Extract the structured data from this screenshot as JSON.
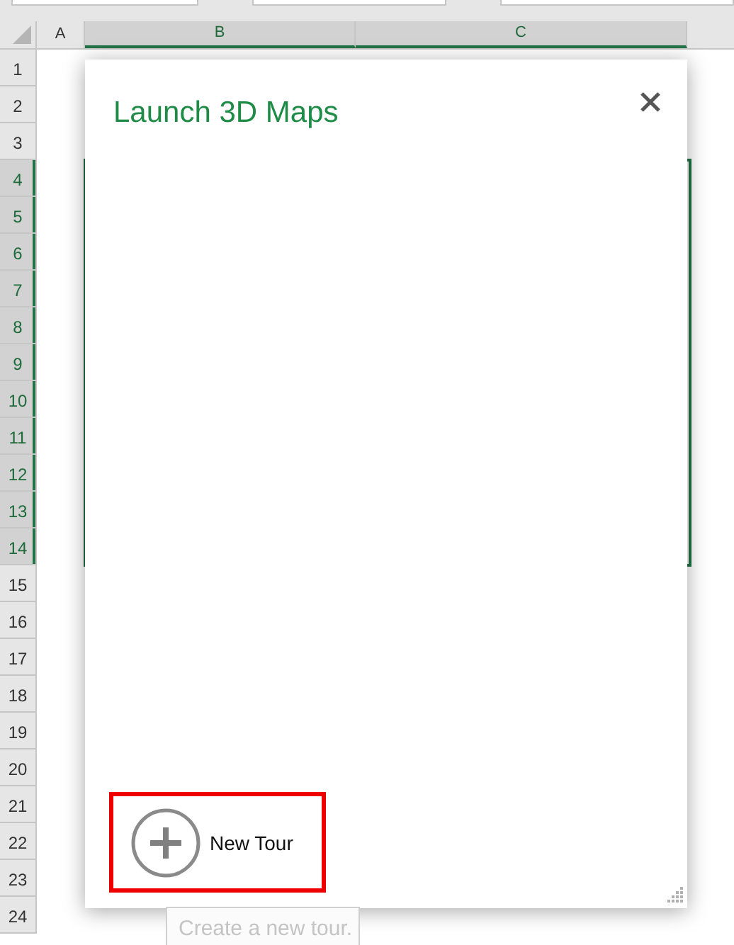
{
  "columns": [
    {
      "label": "A",
      "selected": false
    },
    {
      "label": "B",
      "selected": true
    },
    {
      "label": "C",
      "selected": true
    }
  ],
  "rows": [
    {
      "label": "1",
      "selected": false
    },
    {
      "label": "2",
      "selected": false
    },
    {
      "label": "3",
      "selected": false
    },
    {
      "label": "4",
      "selected": true
    },
    {
      "label": "5",
      "selected": true
    },
    {
      "label": "6",
      "selected": true
    },
    {
      "label": "7",
      "selected": true
    },
    {
      "label": "8",
      "selected": true
    },
    {
      "label": "9",
      "selected": true
    },
    {
      "label": "10",
      "selected": true
    },
    {
      "label": "11",
      "selected": true
    },
    {
      "label": "12",
      "selected": true
    },
    {
      "label": "13",
      "selected": true
    },
    {
      "label": "14",
      "selected": true
    },
    {
      "label": "15",
      "selected": false
    },
    {
      "label": "16",
      "selected": false
    },
    {
      "label": "17",
      "selected": false
    },
    {
      "label": "18",
      "selected": false
    },
    {
      "label": "19",
      "selected": false
    },
    {
      "label": "20",
      "selected": false
    },
    {
      "label": "21",
      "selected": false
    },
    {
      "label": "22",
      "selected": false
    },
    {
      "label": "23",
      "selected": false
    },
    {
      "label": "24",
      "selected": false
    }
  ],
  "dialog": {
    "title": "Launch 3D Maps",
    "new_tour": {
      "label": "New Tour",
      "highlighted": true
    },
    "tooltip": "Create a new tour."
  }
}
